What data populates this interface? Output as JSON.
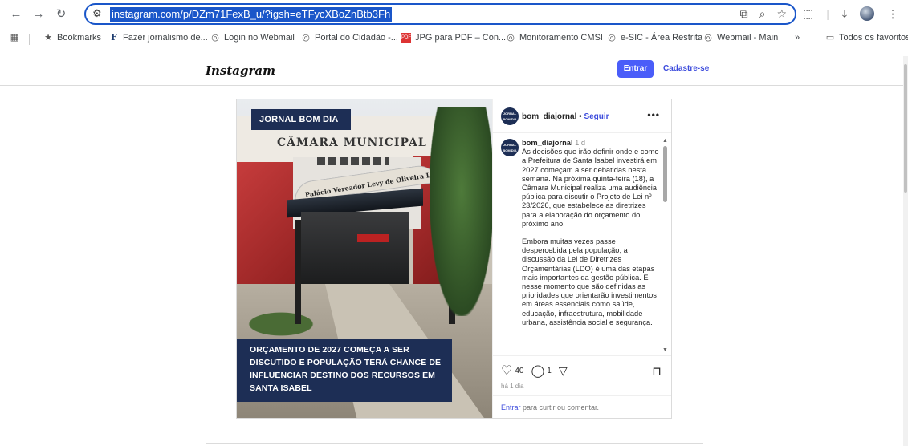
{
  "browser": {
    "url": "instagram.com/p/DZm71FexB_u/?igsh=eTFycXBoZnBtb3Fh",
    "bookmarks": [
      {
        "label": "Bookmarks",
        "icon": "star-icon"
      },
      {
        "label": "Fazer jornalismo de...",
        "icon": "f-logo-icon"
      },
      {
        "label": "Login no Webmail",
        "icon": "globe-icon"
      },
      {
        "label": "Portal do Cidadão -...",
        "icon": "globe-icon"
      },
      {
        "label": "JPG para PDF – Con...",
        "icon": "pdf-icon"
      },
      {
        "label": "Monitoramento CMSI",
        "icon": "globe-icon"
      },
      {
        "label": "e-SIC - Área Restrita",
        "icon": "globe-icon"
      },
      {
        "label": "Webmail - Main",
        "icon": "globe-icon"
      }
    ],
    "overflow": "»",
    "all_favorites": "Todos os favoritos"
  },
  "instagram": {
    "logo": "Instagram",
    "login_button": "Entrar",
    "signup_link": "Cadastre-se"
  },
  "post": {
    "image": {
      "tag": "JORNAL BOM DIA",
      "building_name": "CÂMARA MUNICIPAL",
      "arch_text": "Palácio Vereador Levy de Oliveira Lima",
      "headline_lines": [
        "ORÇAMENTO DE 2027 COMEÇA A SER",
        "DISCUTIDO E POPULAÇÃO TERÁ CHANCE DE",
        "INFLUENCIAR DESTINO DOS RECURSOS EM",
        "SANTA ISABEL"
      ]
    },
    "author": {
      "username": "bom_diajornal",
      "separator": "•",
      "follow": "Seguir",
      "avatar_text": "JORNAL BOM DIA"
    },
    "more": "•••",
    "caption": {
      "username": "bom_diajornal",
      "time": "1 d",
      "paragraphs": [
        "As decisões que irão definir onde e como a Prefeitura de Santa Isabel investirá em 2027 começam a ser debatidas nesta semana. Na próxima quinta-feira (18), a Câmara Municipal realiza uma audiência pública para discutir o Projeto de Lei nº 23/2026, que estabelece as diretrizes para a elaboração do orçamento do próximo ano.",
        "Embora muitas vezes passe despercebida pela população, a discussão da Lei de Diretrizes Orçamentárias (LDO) é uma das etapas mais importantes da gestão pública. É nesse momento que são definidas as prioridades que orientarão investimentos em áreas essenciais como saúde, educação, infraestrutura, mobilidade urbana, assistência social e segurança."
      ]
    },
    "likes": "40",
    "comments": "1",
    "time_ago": "há 1 dia",
    "login_prompt_link": "Entrar",
    "login_prompt_text": " para curtir ou comentar."
  }
}
